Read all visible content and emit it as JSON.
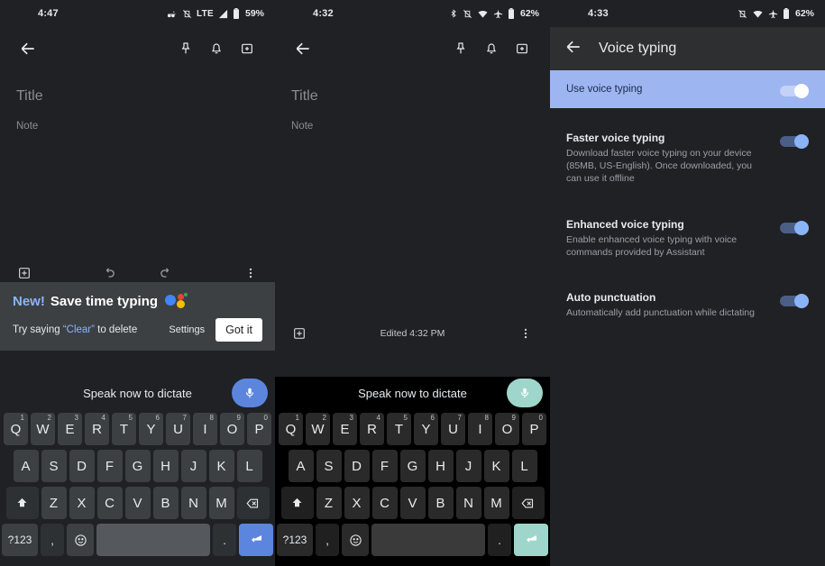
{
  "panels": {
    "left": {
      "status": {
        "time": "4:47",
        "network": "LTE",
        "battery": "59%"
      },
      "appbar": {
        "back": "back-arrow",
        "pin": "pin",
        "remind": "reminder-bell",
        "archive": "archive"
      },
      "note": {
        "title_placeholder": "Title",
        "body_placeholder": "Note"
      },
      "toolbar": {
        "add": "add-box",
        "undo": "undo",
        "redo": "redo",
        "more": "more-vert"
      },
      "promo": {
        "new_label": "New!",
        "headline": "Save time typing",
        "sub_prefix": "Try saying ",
        "sub_quoted": "“Clear”",
        "sub_suffix": " to delete",
        "settings_label": "Settings",
        "gotit_label": "Got it"
      },
      "keyboard": {
        "dictation_hint": "Speak now to dictate",
        "mic_color": "#5c85de",
        "enter_color": "#5c85de",
        "theme": "dark",
        "row1": [
          {
            "k": "Q",
            "n": "1"
          },
          {
            "k": "W",
            "n": "2"
          },
          {
            "k": "E",
            "n": "3"
          },
          {
            "k": "R",
            "n": "4"
          },
          {
            "k": "T",
            "n": "5"
          },
          {
            "k": "Y",
            "n": "6"
          },
          {
            "k": "U",
            "n": "7"
          },
          {
            "k": "I",
            "n": "8"
          },
          {
            "k": "O",
            "n": "9"
          },
          {
            "k": "P",
            "n": "0"
          }
        ],
        "row2": [
          "A",
          "S",
          "D",
          "F",
          "G",
          "H",
          "J",
          "K",
          "L"
        ],
        "row3": [
          "Z",
          "X",
          "C",
          "V",
          "B",
          "N",
          "M"
        ],
        "symbols_label": "?123",
        "comma_label": ",",
        "period_label": ".",
        "shift_icon": "shift-arrow-up",
        "backspace_icon": "backspace",
        "emoji_icon": "emoji-smiley",
        "enter_icon": "enter-return",
        "space_label": ""
      }
    },
    "middle": {
      "status": {
        "time": "4:32",
        "battery": "62%"
      },
      "appbar": {
        "back": "back-arrow",
        "pin": "pin",
        "remind": "reminder-bell",
        "archive": "archive"
      },
      "note": {
        "title_placeholder": "Title",
        "body_placeholder": "Note"
      },
      "toolbar": {
        "add": "add-box",
        "edited": "Edited 4:32 PM",
        "more": "more-vert"
      },
      "keyboard": {
        "dictation_hint": "Speak now to dictate",
        "mic_color": "#9fd6cb",
        "enter_color": "#9fd6cb",
        "theme": "black",
        "row1": [
          {
            "k": "Q",
            "n": "1"
          },
          {
            "k": "W",
            "n": "2"
          },
          {
            "k": "E",
            "n": "3"
          },
          {
            "k": "R",
            "n": "4"
          },
          {
            "k": "T",
            "n": "5"
          },
          {
            "k": "Y",
            "n": "6"
          },
          {
            "k": "U",
            "n": "7"
          },
          {
            "k": "I",
            "n": "8"
          },
          {
            "k": "O",
            "n": "9"
          },
          {
            "k": "P",
            "n": "0"
          }
        ],
        "row2": [
          "A",
          "S",
          "D",
          "F",
          "G",
          "H",
          "J",
          "K",
          "L"
        ],
        "row3": [
          "Z",
          "X",
          "C",
          "V",
          "B",
          "N",
          "M"
        ],
        "symbols_label": "?123",
        "comma_label": ",",
        "period_label": ".",
        "shift_icon": "shift-arrow-up",
        "backspace_icon": "backspace",
        "emoji_icon": "emoji-smiley",
        "enter_icon": "enter-return",
        "space_label": ""
      }
    },
    "right": {
      "status": {
        "time": "4:33",
        "battery": "62%"
      },
      "appbar": {
        "back": "back-arrow",
        "title": "Voice typing"
      },
      "master_toggle": {
        "label": "Use voice typing",
        "state": "on"
      },
      "settings": [
        {
          "title": "Faster voice typing",
          "subtitle": "Download faster voice typing on your device (85MB, US-English). Once downloaded, you can use it offline",
          "state": "on"
        },
        {
          "title": "Enhanced voice typing",
          "subtitle": "Enable enhanced voice typing with voice commands provided by Assistant",
          "state": "on"
        },
        {
          "title": "Auto punctuation",
          "subtitle": "Automatically add punctuation while dictating",
          "state": "on"
        }
      ]
    }
  },
  "colors": {
    "accent_blue": "#8ab4f8",
    "mint": "#9fd6cb",
    "key_blue": "#5c85de",
    "panel_bg": "#202124",
    "master_row_bg": "#9db5f0"
  }
}
